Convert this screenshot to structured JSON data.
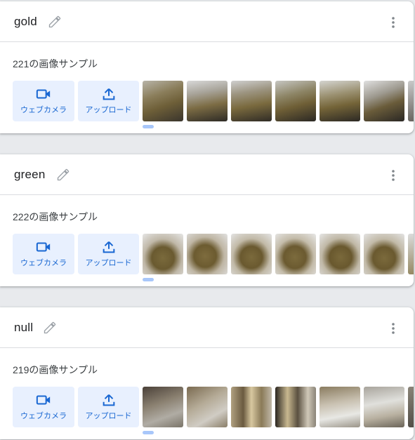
{
  "classes": [
    {
      "name": "gold",
      "sample_count": "221の画像サンプル",
      "webcam_label": "ウェブカメラ",
      "upload_label": "アップロード",
      "thumbnail_style": "kiwi-dark"
    },
    {
      "name": "green",
      "sample_count": "222の画像サンプル",
      "webcam_label": "ウェブカメラ",
      "upload_label": "アップロード",
      "thumbnail_style": "kiwi-green"
    },
    {
      "name": "null",
      "sample_count": "219の画像サンプル",
      "webcam_label": "ウェブカメラ",
      "upload_label": "アップロード",
      "thumbnail_style": "blurry-room"
    }
  ],
  "icons": {
    "edit": "pencil-icon",
    "more": "more-vert-icon",
    "webcam": "videocam-icon",
    "upload": "upload-icon"
  },
  "colors": {
    "accent": "#1967d2",
    "button_bg": "#e8f0fe",
    "page_bg": "#e8eaed"
  }
}
